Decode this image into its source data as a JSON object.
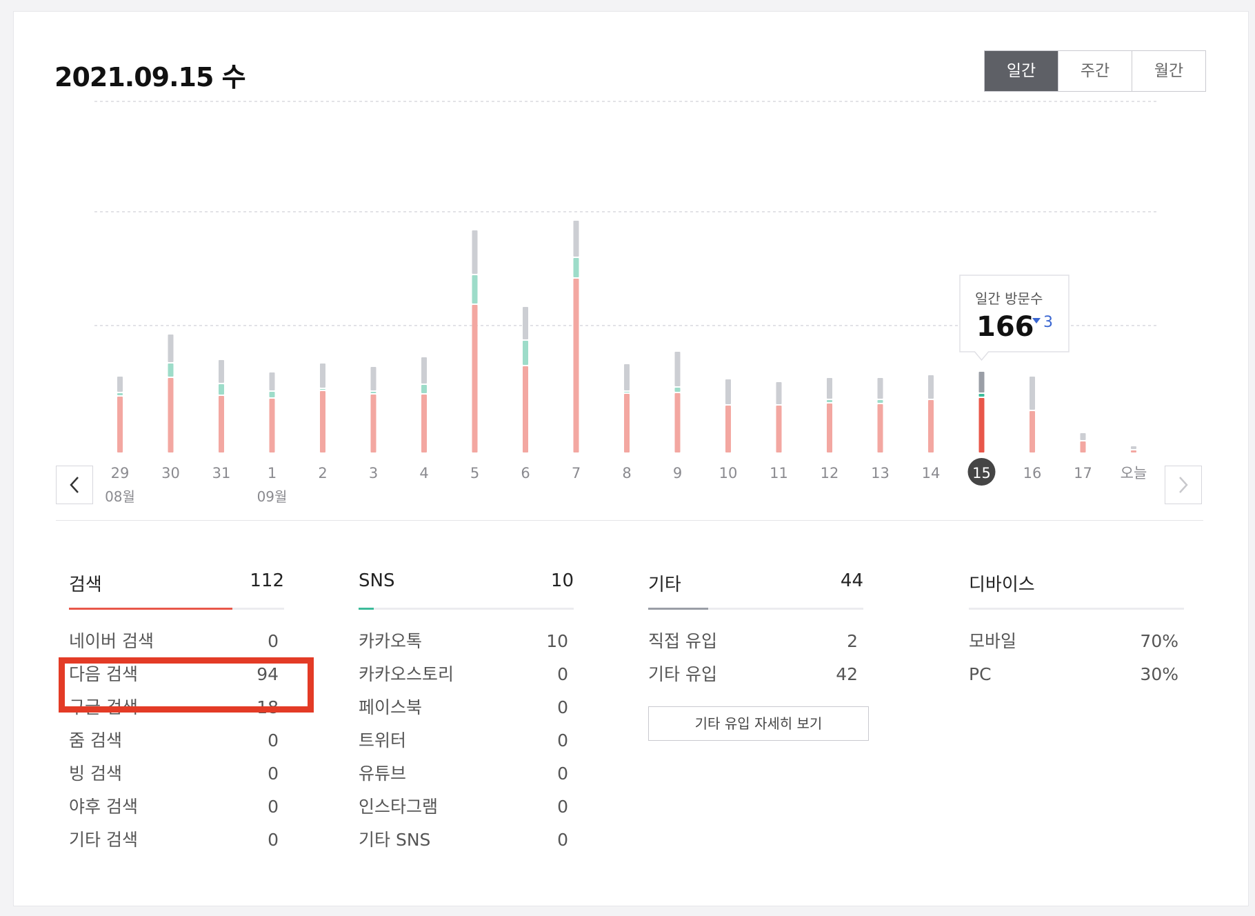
{
  "header": {
    "date_title": "2021.09.15 수",
    "period_tabs": [
      {
        "label": "일간",
        "active": true
      },
      {
        "label": "주간",
        "active": false
      },
      {
        "label": "월간",
        "active": false
      }
    ]
  },
  "chart_data": {
    "type": "bar",
    "stacked": true,
    "categories": [
      "29",
      "30",
      "31",
      "1",
      "2",
      "3",
      "4",
      "5",
      "6",
      "7",
      "8",
      "9",
      "10",
      "11",
      "12",
      "13",
      "14",
      "15",
      "16",
      "17",
      "오늘"
    ],
    "month_labels": [
      {
        "at": "29",
        "label": "08월"
      },
      {
        "at": "1",
        "label": "09월"
      }
    ],
    "series": [
      {
        "color": "#f3a7a1",
        "values": [
          83,
          110,
          84,
          80,
          91,
          86,
          86,
          216,
          127,
          254,
          87,
          88,
          70,
          70,
          73,
          72,
          78,
          81,
          62,
          18,
          5
        ]
      },
      {
        "color": "#9ddcc9",
        "values": [
          5,
          21,
          17,
          10,
          3,
          4,
          14,
          43,
          37,
          30,
          3,
          8,
          0,
          0,
          5,
          6,
          0,
          6,
          0,
          0,
          0
        ]
      },
      {
        "color": "#ccced3",
        "values": [
          24,
          42,
          35,
          28,
          37,
          36,
          40,
          65,
          49,
          54,
          40,
          52,
          38,
          34,
          32,
          32,
          36,
          32,
          50,
          12,
          6
        ]
      }
    ],
    "selected": "15",
    "selected_colors": [
      "#e8574a",
      "#3dbb9a",
      "#9a9ea6"
    ],
    "grid": true,
    "ylim": [
      0,
      440
    ],
    "tooltip": {
      "label": "일간 방문수",
      "value": "166",
      "change_icon": "triangle-down-icon",
      "change": "3"
    }
  },
  "stats": {
    "search": {
      "title": "검색",
      "total": "112",
      "accent": "#e8574a",
      "fill": 0.76,
      "rows": [
        {
          "label": "네이버 검색",
          "value": "0"
        },
        {
          "label": "다음 검색",
          "value": "94"
        },
        {
          "label": "구글 검색",
          "value": "18"
        },
        {
          "label": "줌 검색",
          "value": "0"
        },
        {
          "label": "빙 검색",
          "value": "0"
        },
        {
          "label": "야후 검색",
          "value": "0"
        },
        {
          "label": "기타 검색",
          "value": "0"
        }
      ]
    },
    "sns": {
      "title": "SNS",
      "total": "10",
      "accent": "#3dbb9a",
      "fill": 0.07,
      "rows": [
        {
          "label": "카카오톡",
          "value": "10"
        },
        {
          "label": "카카오스토리",
          "value": "0"
        },
        {
          "label": "페이스북",
          "value": "0"
        },
        {
          "label": "트위터",
          "value": "0"
        },
        {
          "label": "유튜브",
          "value": "0"
        },
        {
          "label": "인스타그램",
          "value": "0"
        },
        {
          "label": "기타 SNS",
          "value": "0"
        }
      ]
    },
    "etc": {
      "title": "기타",
      "total": "44",
      "accent": "#9a9ea6",
      "fill": 0.28,
      "rows": [
        {
          "label": "직접 유입",
          "value": "2"
        },
        {
          "label": "기타 유입",
          "value": "42"
        }
      ],
      "more_label": "기타 유입 자세히 보기"
    },
    "device": {
      "title": "디바이스",
      "rows": [
        {
          "label": "모바일",
          "value": "70%"
        },
        {
          "label": "PC",
          "value": "30%"
        }
      ]
    }
  }
}
